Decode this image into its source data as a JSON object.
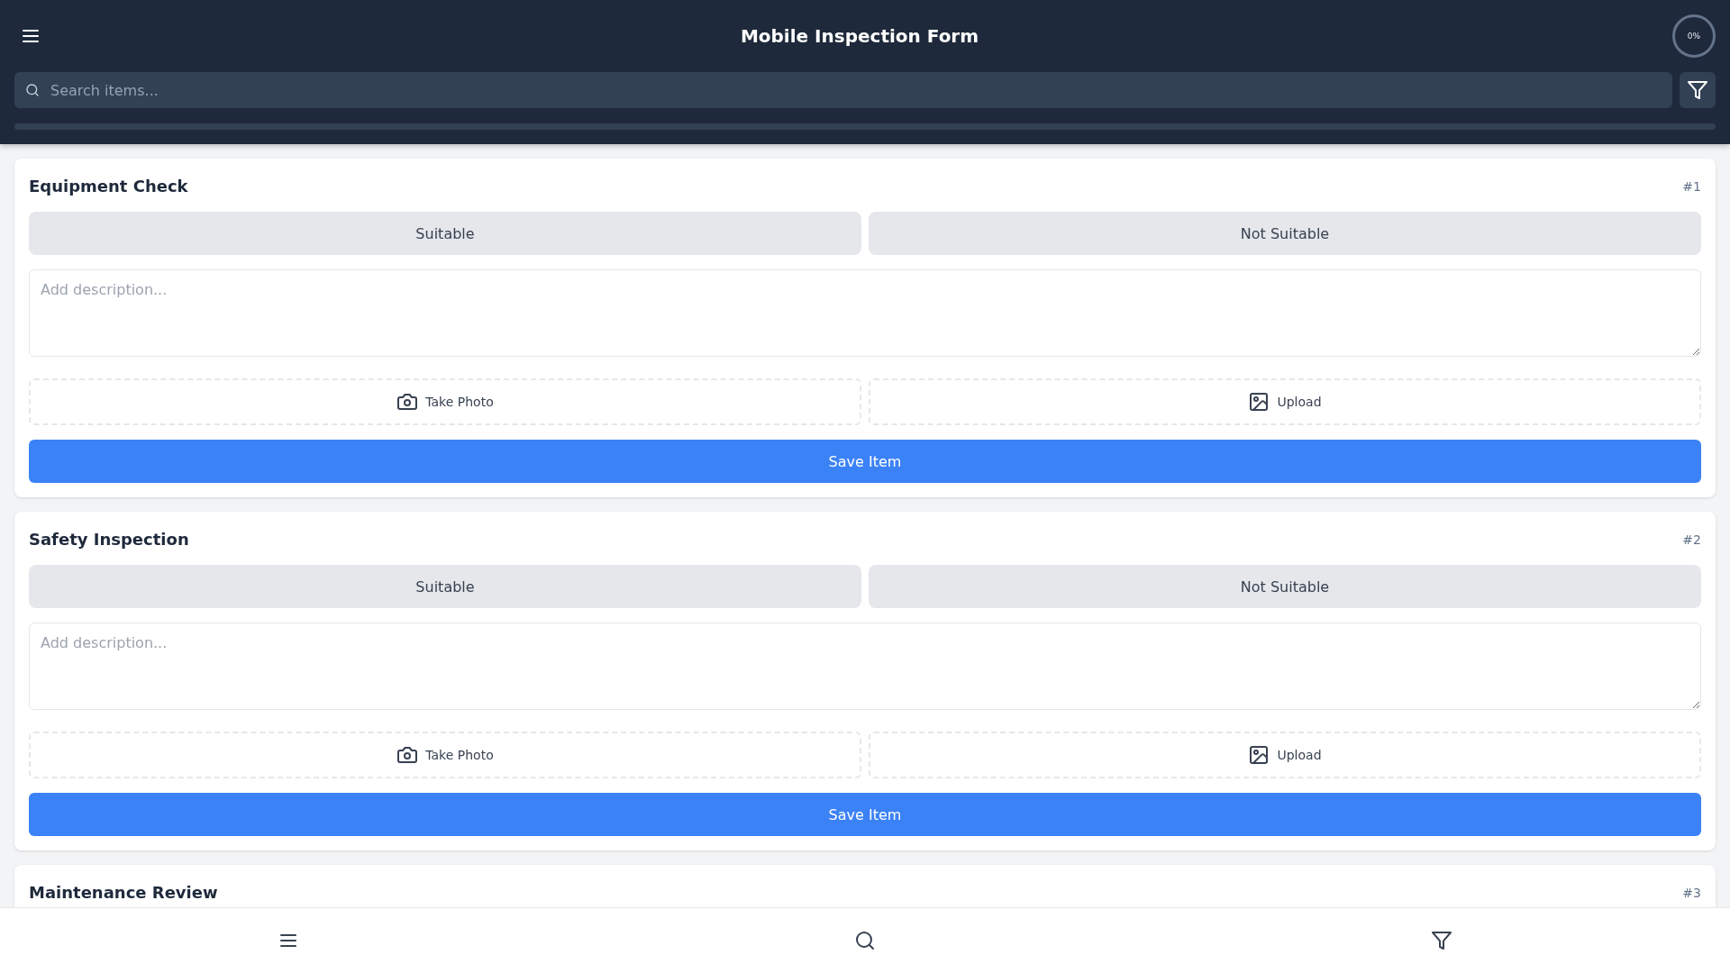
{
  "header": {
    "title": "Mobile Inspection Form",
    "progress_label": "0%",
    "progress": {
      "level": 0
    }
  },
  "search": {
    "placeholder": "Search items..."
  },
  "items": [
    {
      "title": "Equipment Check",
      "number": "#1",
      "options": [
        {
          "label": "Suitable",
          "selected": false
        },
        {
          "label": "Not Suitable",
          "selected": false
        }
      ],
      "description": {
        "placeholder": "Add description..."
      },
      "photo_buttons": [
        {
          "kind": "camera",
          "label": "Take Photo"
        },
        {
          "kind": "upload",
          "label": "Upload"
        }
      ],
      "save": "Save Item"
    },
    {
      "title": "Safety Inspection",
      "number": "#2",
      "options": [
        {
          "label": "Suitable",
          "selected": false
        },
        {
          "label": "Not Suitable",
          "selected": false
        }
      ],
      "description": {
        "placeholder": "Add description..."
      },
      "photo_buttons": [
        {
          "kind": "camera",
          "label": "Take Photo"
        },
        {
          "kind": "upload",
          "label": "Upload"
        }
      ],
      "save": "Save Item"
    },
    {
      "title": "Maintenance Review",
      "number": "#3"
    }
  ],
  "bottom_nav": [
    {
      "kind": "menu"
    },
    {
      "kind": "search"
    },
    {
      "kind": "filter"
    }
  ]
}
